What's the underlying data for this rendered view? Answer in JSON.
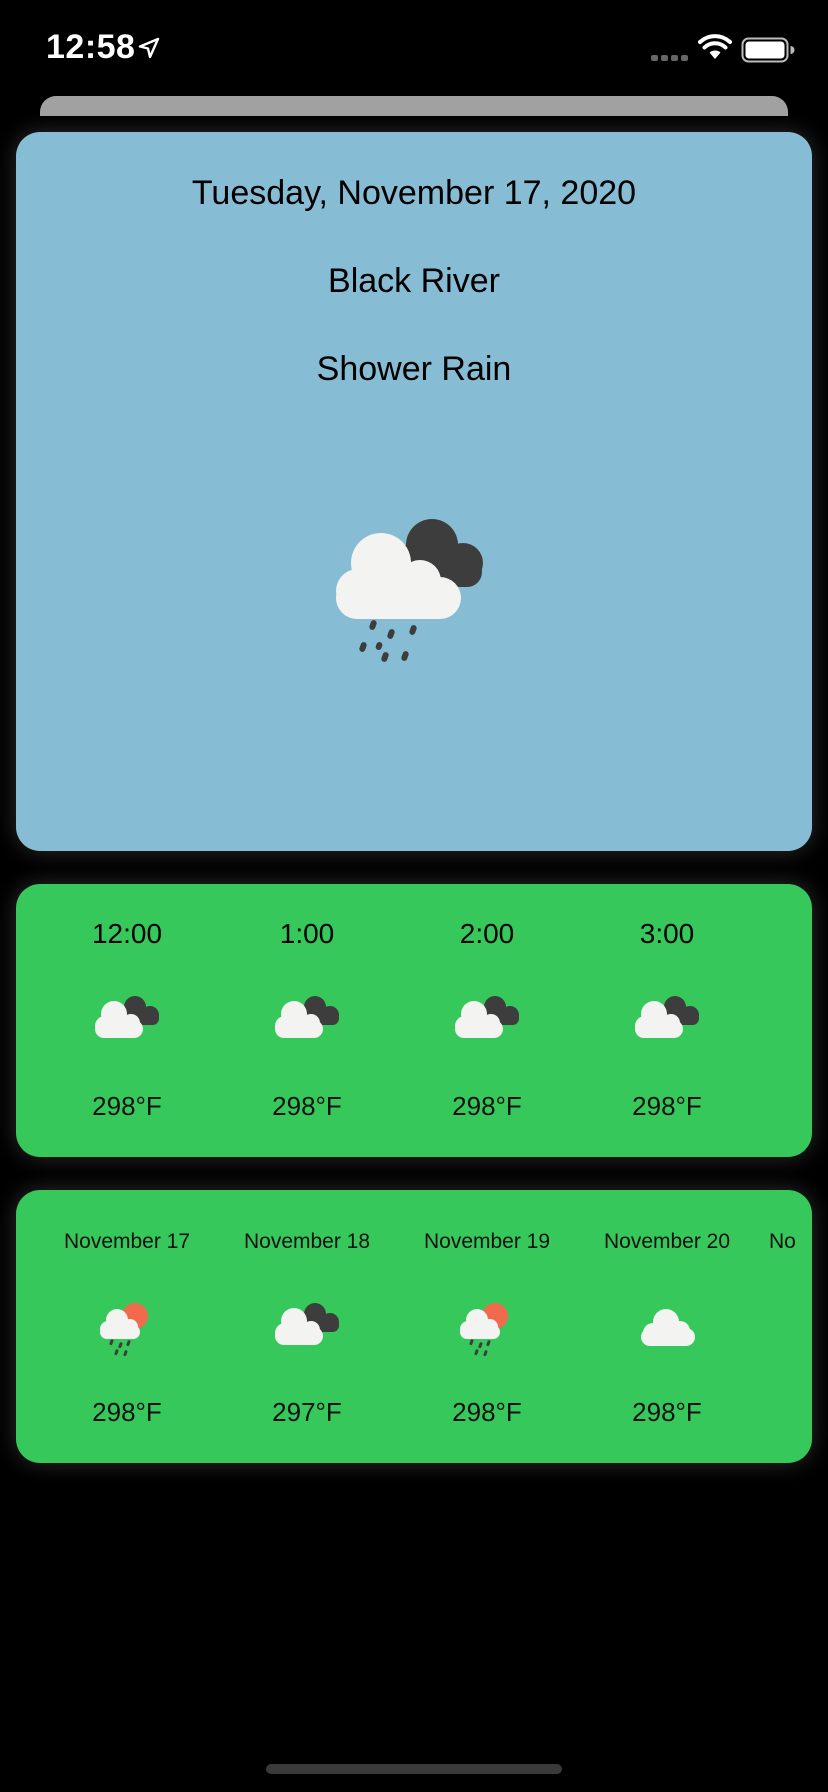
{
  "status_bar": {
    "time": "12:58"
  },
  "current": {
    "date": "Tuesday, November 17, 2020",
    "city": "Black River",
    "condition": "Shower Rain",
    "icon": "shower-rain-icon"
  },
  "hourly": [
    {
      "time": "12:00",
      "icon": "broken-clouds-icon",
      "temp": "298°F"
    },
    {
      "time": "1:00",
      "icon": "broken-clouds-icon",
      "temp": "298°F"
    },
    {
      "time": "2:00",
      "icon": "broken-clouds-icon",
      "temp": "298°F"
    },
    {
      "time": "3:00",
      "icon": "broken-clouds-icon",
      "temp": "298°F"
    }
  ],
  "daily": [
    {
      "date": "November 17",
      "icon": "sun-rain-icon",
      "temp": "298°F"
    },
    {
      "date": "November 18",
      "icon": "broken-clouds-icon",
      "temp": "297°F"
    },
    {
      "date": "November 19",
      "icon": "sun-rain-icon",
      "temp": "298°F"
    },
    {
      "date": "November 20",
      "icon": "cloud-icon",
      "temp": "298°F"
    }
  ],
  "daily_partial": "No",
  "colors": {
    "current_card": "#87bdd4",
    "forecast_card": "#36c85b",
    "sun": "#f06a4e"
  }
}
